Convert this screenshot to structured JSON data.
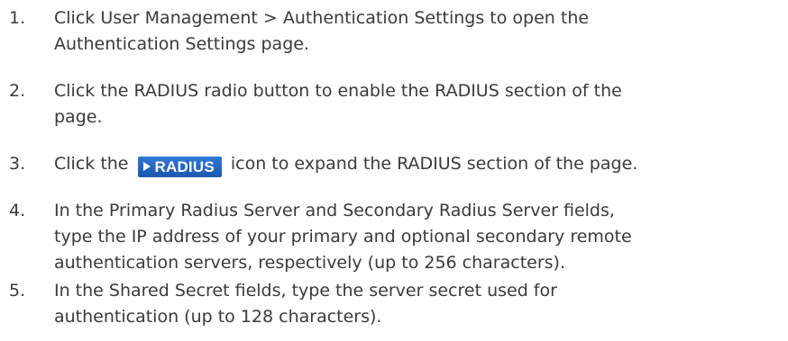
{
  "steps": [
    {
      "number": "1.",
      "lines": [
        "Click User Management > Authentication Settings to open the",
        "Authentication Settings page."
      ]
    },
    {
      "number": "2.",
      "lines": [
        "Click the RADIUS radio button to enable the RADIUS section of the",
        "page."
      ]
    },
    {
      "number": "3.",
      "before_icon": "Click the",
      "icon_label": "RADIUS",
      "after_icon": "icon to expand the RADIUS section of the page."
    },
    {
      "number": "4.",
      "lines": [
        "In the Primary Radius Server and Secondary Radius Server fields,",
        "type the IP address of your primary and optional secondary remote",
        "authentication servers, respectively (up to 256 characters)."
      ]
    },
    {
      "number": "5.",
      "lines": [
        "In the Shared Secret fields, type the server secret used for",
        "authentication (up to 128 characters)."
      ]
    }
  ]
}
